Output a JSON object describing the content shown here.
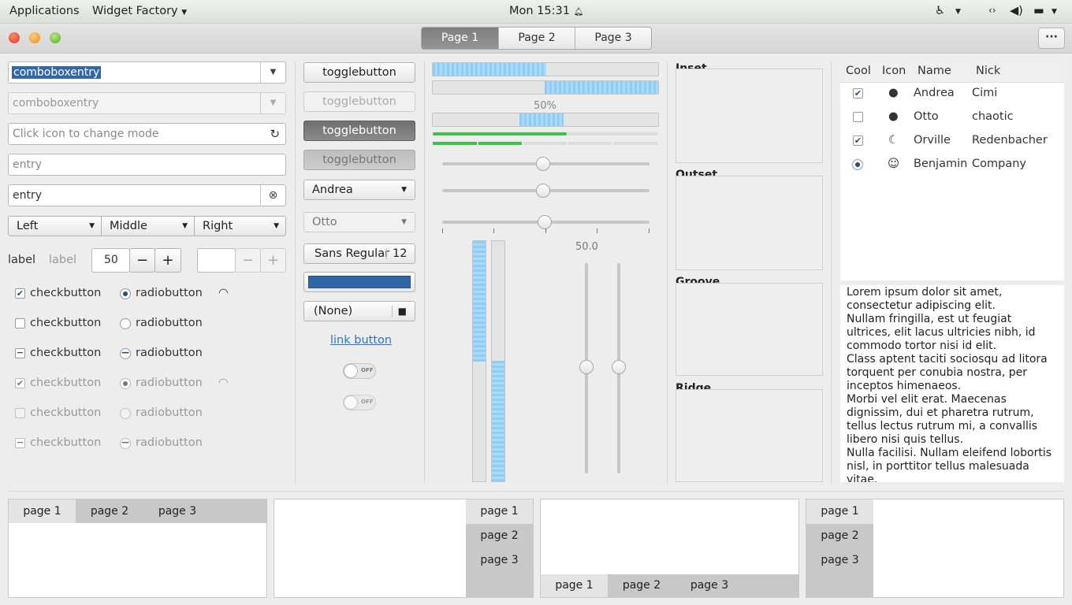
{
  "topbar": {
    "applications": "Applications",
    "app_menu": "Widget Factory",
    "clock": "Mon 15:31"
  },
  "stack_tabs": [
    "Page 1",
    "Page 2",
    "Page 3"
  ],
  "left": {
    "combo1": "comboboxentry",
    "combo2": "comboboxentry",
    "entry_placeholder": "Click icon to change mode",
    "entry_placeholder2": "entry",
    "entry3": "entry",
    "segmented": [
      "Left",
      "Middle",
      "Right"
    ],
    "label1": "label",
    "label2": "label",
    "spin_value": "50",
    "spin_minus": "−",
    "spin_plus": "+",
    "checks": [
      "checkbutton",
      "checkbutton",
      "checkbutton",
      "checkbutton",
      "checkbutton",
      "checkbutton"
    ],
    "radios": [
      "radiobutton",
      "radiobutton",
      "radiobutton",
      "radiobutton",
      "radiobutton",
      "radiobutton"
    ]
  },
  "middle": {
    "toggles": [
      "togglebutton",
      "togglebutton",
      "togglebutton",
      "togglebutton"
    ],
    "combo_andrea": "Andrea",
    "combo_otto": "Otto",
    "font_name": "Sans Regular",
    "font_size": "12",
    "color_value": "#2f66a6",
    "file_none": "(None)",
    "link": "link button",
    "switch_off": "OFF"
  },
  "progress": {
    "bar1": 0.5,
    "bar2": 0.5,
    "bar3_label": "50%",
    "level_fill": 0.6,
    "scale_value": "50.0"
  },
  "frames": [
    "Inset",
    "Outset",
    "Groove",
    "Ridge"
  ],
  "tree": {
    "headers": [
      "Cool",
      "Icon",
      "Name",
      "Nick"
    ],
    "rows": [
      {
        "name": "Andrea",
        "nick": "Cimi",
        "icon": "check-icon"
      },
      {
        "name": "Otto",
        "nick": "chaotic",
        "icon": "alert-icon"
      },
      {
        "name": "Orville",
        "nick": "Redenbacher",
        "icon": "moon-icon"
      },
      {
        "name": "Benjamin",
        "nick": "Company",
        "icon": "face-icon"
      }
    ]
  },
  "textview": "Lorem ipsum dolor sit amet, consectetur adipiscing elit.\nNullam fringilla, est ut feugiat ultrices, elit lacus ultricies nibh, id commodo tortor nisi id elit.\nClass aptent taciti sociosqu ad litora torquent per conubia nostra, per inceptos himenaeos.\nMorbi vel elit erat. Maecenas dignissim, dui et pharetra rutrum, tellus lectus rutrum mi, a convallis libero nisi quis tellus.\nNulla facilisi. Nullam eleifend lobortis nisl, in porttitor tellus malesuada vitae.\nAenean lacus tellus, pellentesque quis",
  "notebooks": [
    "page 1",
    "page 2",
    "page 3"
  ],
  "colors": {
    "accent": "#2f66a6",
    "progress": "#8fcdf5",
    "level": "#3fc04e"
  }
}
